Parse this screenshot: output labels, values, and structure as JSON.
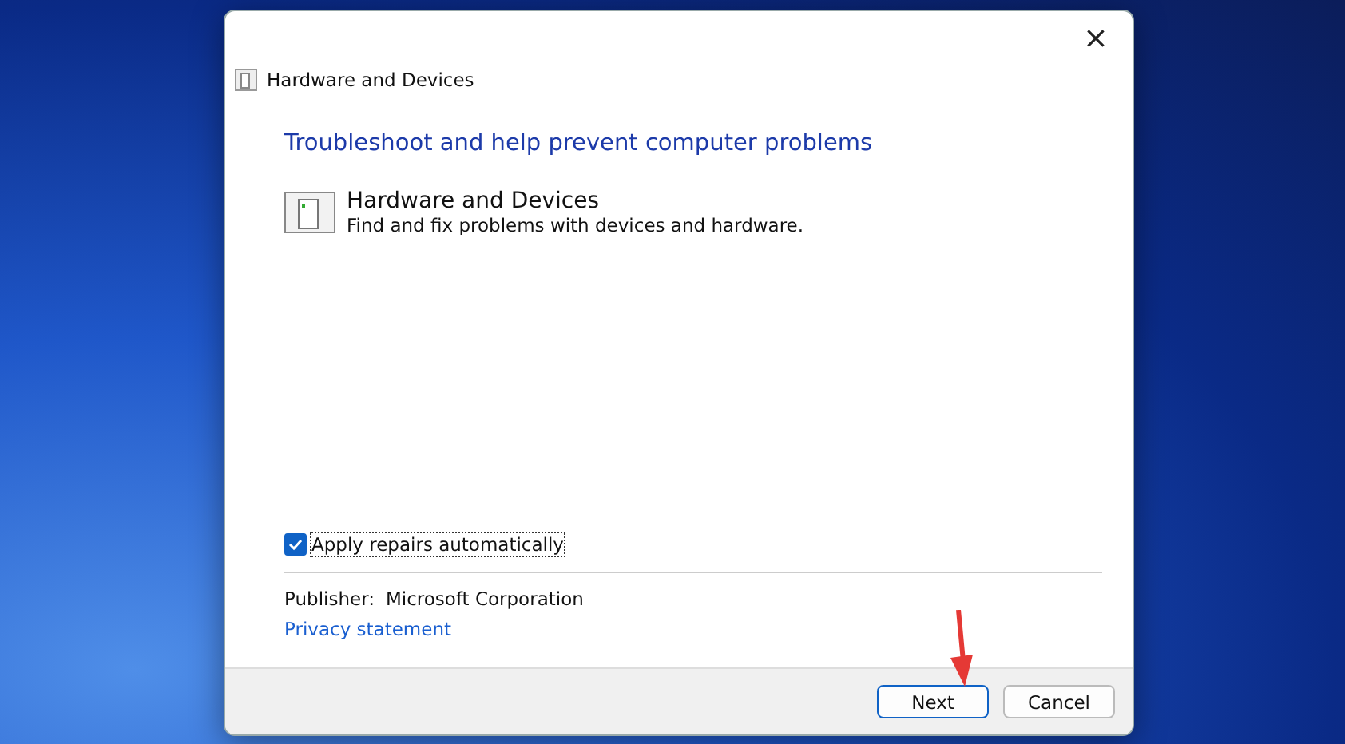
{
  "window": {
    "title": "Hardware and Devices",
    "close": "×"
  },
  "heading": "Troubleshoot and help prevent computer problems",
  "troubleshooter": {
    "name": "Hardware and Devices",
    "description": "Find and fix problems with devices and hardware."
  },
  "apply_repairs": {
    "label": "Apply repairs automatically",
    "checked": true
  },
  "publisher": {
    "label": "Publisher:",
    "value": "Microsoft Corporation"
  },
  "privacy_link": "Privacy statement",
  "buttons": [
    {
      "label": "Next",
      "selected": true
    },
    {
      "label": "Cancel",
      "selected": false
    }
  ]
}
